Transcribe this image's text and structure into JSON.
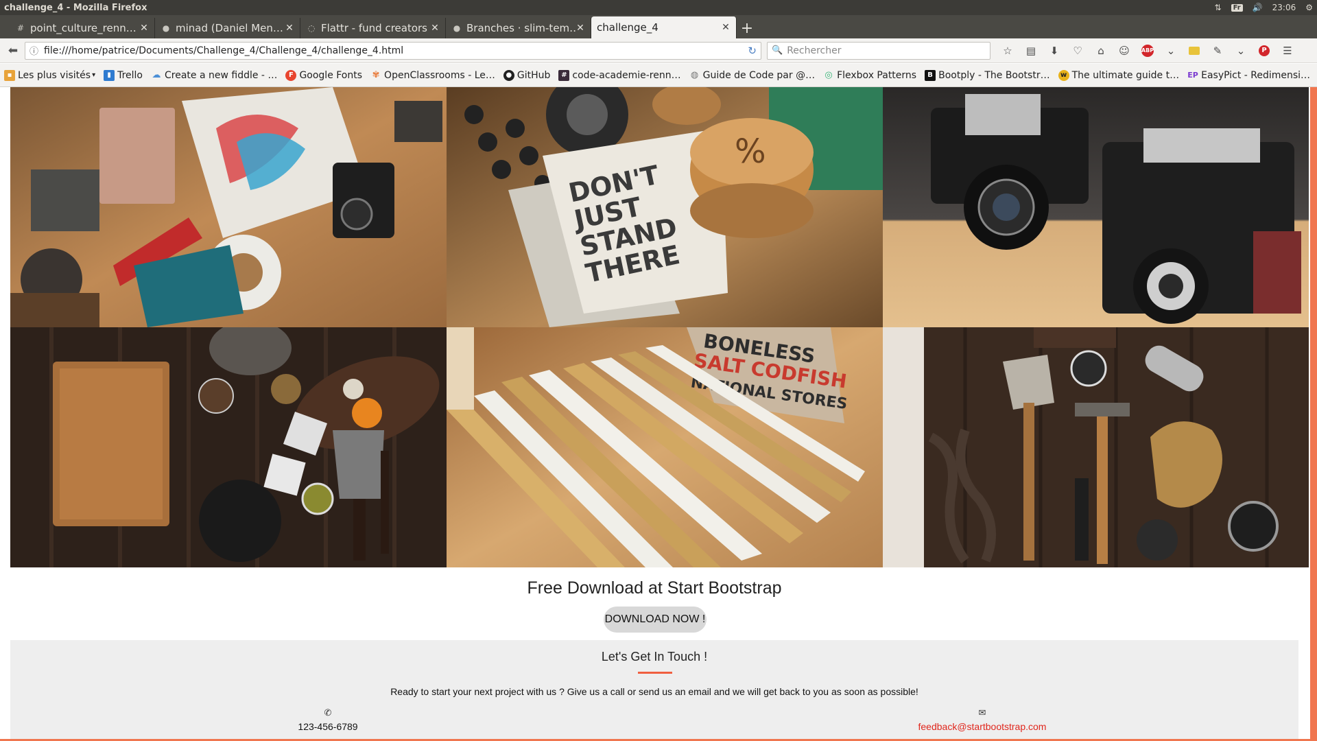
{
  "window": {
    "title": "challenge_4 - Mozilla Firefox",
    "tray": {
      "keyboard": "Fr",
      "clock": "23:06"
    }
  },
  "tabs": [
    {
      "label": "point_culture_renn…",
      "icon": "hash-icon",
      "active": false
    },
    {
      "label": "minad (Daniel Men…",
      "icon": "github-icon",
      "active": false
    },
    {
      "label": "Flattr - fund creators",
      "icon": "flattr-icon",
      "active": false
    },
    {
      "label": "Branches · slim-tem…",
      "icon": "github-icon",
      "active": false
    },
    {
      "label": "challenge_4",
      "icon": "",
      "active": true
    }
  ],
  "navbar": {
    "url": "file:///home/patrice/Documents/Challenge_4/Challenge_4/challenge_4.html",
    "search_placeholder": "Rechercher"
  },
  "bookmarks": [
    {
      "label": "Les plus visités",
      "icon": "folder-icon",
      "color": "#e8a33a"
    },
    {
      "label": "Trello",
      "icon": "trello-icon",
      "color": "#2f7bd0"
    },
    {
      "label": "Create a new fiddle - …",
      "icon": "jsfiddle-icon",
      "color": "#4b8fd6"
    },
    {
      "label": "Google Fonts",
      "icon": "google-fonts-icon",
      "color": "#e8452f"
    },
    {
      "label": "OpenClassrooms - Le…",
      "icon": "openclassrooms-icon",
      "color": "#e87a3a"
    },
    {
      "label": "GitHub",
      "icon": "github-icon",
      "color": "#222222"
    },
    {
      "label": "code-academie-renn…",
      "icon": "slack-hash-icon",
      "color": "#3a2b3a"
    },
    {
      "label": "Guide de Code par @…",
      "icon": "globe-icon",
      "color": "#777777"
    },
    {
      "label": "Flexbox Patterns",
      "icon": "flexbox-icon",
      "color": "#3cb67a"
    },
    {
      "label": "Bootply - The Bootstr…",
      "icon": "bootply-icon",
      "color": "#111111"
    },
    {
      "label": "The ultimate guide t…",
      "icon": "w-icon",
      "color": "#e8b21a"
    },
    {
      "label": "EasyPict - Redimensi…",
      "icon": "ep-icon",
      "color": "#7b3ad0"
    }
  ],
  "portfolio": [
    {
      "subject": "desk-flatlay",
      "base": "#b67a48"
    },
    {
      "subject": "notebook-dont-just-stand-there",
      "base": "#8b6a45"
    },
    {
      "subject": "vintage-cameras",
      "base": "#6e6a66"
    },
    {
      "subject": "kitchen-table",
      "base": "#3a2a20"
    },
    {
      "subject": "folding-rulers",
      "base": "#b4824f"
    },
    {
      "subject": "tools-flatlay",
      "base": "#3d2c22"
    }
  ],
  "hero": {
    "title": "Free Download at Start Bootstrap",
    "button": "DOWNLOAD NOW !"
  },
  "contact": {
    "heading": "Let's Get In Touch !",
    "lead": "Ready to start your next project with us ? Give us a call or send us an email and we will get back to you as soon as possible!",
    "phone": "123-456-6789",
    "email": "feedback@startbootstrap.com",
    "accent": "#f05f40"
  }
}
